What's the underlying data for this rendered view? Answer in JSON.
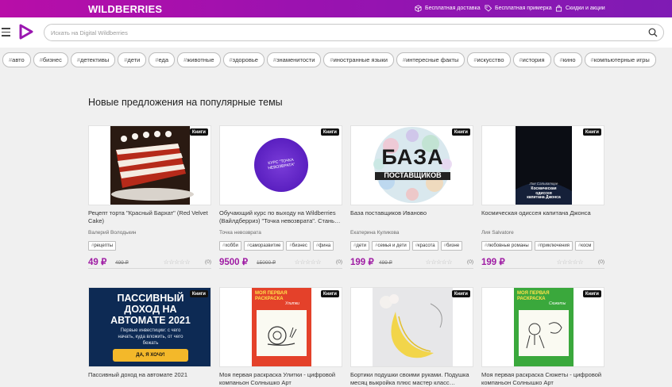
{
  "brand": {
    "logo": "WILDBERRIES"
  },
  "topbar": {
    "links": [
      {
        "label": "Бесплатная доставка",
        "icon": "box-icon"
      },
      {
        "label": "Бесплатная примерка",
        "icon": "tag-icon"
      },
      {
        "label": "Скидки и акции",
        "icon": "bag-icon"
      }
    ]
  },
  "search": {
    "placeholder": "Искать на Digital Wildberries",
    "value": ""
  },
  "tags": [
    "авто",
    "бизнес",
    "детективы",
    "дети",
    "еда",
    "животные",
    "здоровье",
    "знаменитости",
    "иностранные языки",
    "интересные факты",
    "искусство",
    "история",
    "кино",
    "компьютерные игры"
  ],
  "section": {
    "title": "Новые предложения на популярные темы"
  },
  "cards": [
    {
      "badge": "Книги",
      "title": "Рецепт торта \"Красный Бархат\" (Red Velvet Cake)",
      "author": "Валерий Володькин",
      "tags": [
        "рецепты"
      ],
      "price": "49 ₽",
      "old_price": "499 ₽",
      "rating_count": "(0)",
      "image": "red-velvet-cake-image"
    },
    {
      "badge": "Книги",
      "title": "Обучающий курс по выходу на Wildberries (Вайлдберриз) \"Точка невозврата\". Стань…",
      "author": "Точка невозврата",
      "tags": [
        "хобби",
        "саморазвитие",
        "бизнес",
        "фина"
      ],
      "price": "9500 ₽",
      "old_price": "15000 ₽",
      "rating_count": "(0)",
      "cover_text": "КУРС \"ТОЧКА НЕВОЗВРАТА\"",
      "image": "purple-circle-course-image"
    },
    {
      "badge": "Книги",
      "title": "База поставщиков Иваново",
      "author": "Екатерина Куликова",
      "tags": [
        "дети",
        "семья и дети",
        "красота",
        "бизне"
      ],
      "price": "199 ₽",
      "old_price": "499 ₽",
      "rating_count": "(0)",
      "cover_text": [
        "БАЗА",
        "ПОСТАВЩИКОВ"
      ],
      "image": "supplier-base-image"
    },
    {
      "badge": "Книги",
      "title": "Космическая одиссея капитана Джонса",
      "author": "Лия Salvatore",
      "tags": [
        "любовные романы",
        "приключения",
        "косм"
      ],
      "price": "199 ₽",
      "old_price": "",
      "rating_count": "(0)",
      "cover_text": [
        "Лия Сальваторе",
        "Космическая",
        "одиссея",
        "капитана Джонса"
      ],
      "image": "space-odyssey-cover-image"
    },
    {
      "badge": "Книги",
      "title": "Пассивный доход на автомате 2021",
      "cover_text": [
        "ПАССИВНЫЙ",
        "ДОХОД НА",
        "АВТОМАТЕ 2021",
        "Первые инвестиции: с чего",
        "начать, куда вложить, от чего",
        "бежать",
        "ДА, Я ХОЧУ!"
      ],
      "image": "passive-income-image"
    },
    {
      "badge": "Книги",
      "title": "Моя первая раскраска Улитки - цифровой компаньон Солнышко Арт",
      "cover_text": [
        "МОЯ ПЕРВАЯ",
        "РАСКРАСКА",
        "Улитки"
      ],
      "image": "snail-coloring-image"
    },
    {
      "badge": "Книги",
      "title": "Бортики подушки своими руками. Подушка месяц выкройка плюс мастер класс…",
      "image": "moon-pillow-image"
    },
    {
      "badge": "Книги",
      "title": "Моя первая раскраска Сюжеты - цифровой компаньон Солнышко Арт",
      "cover_text": [
        "МОЯ ПЕРВАЯ",
        "РАСКРАСКА",
        "Сюжеты"
      ],
      "image": "story-coloring-image"
    }
  ],
  "colors": {
    "topbar_start": "#b80ea8",
    "topbar_end": "#7f1bb4",
    "price": "#9e1ba3",
    "badge": "#111111"
  }
}
